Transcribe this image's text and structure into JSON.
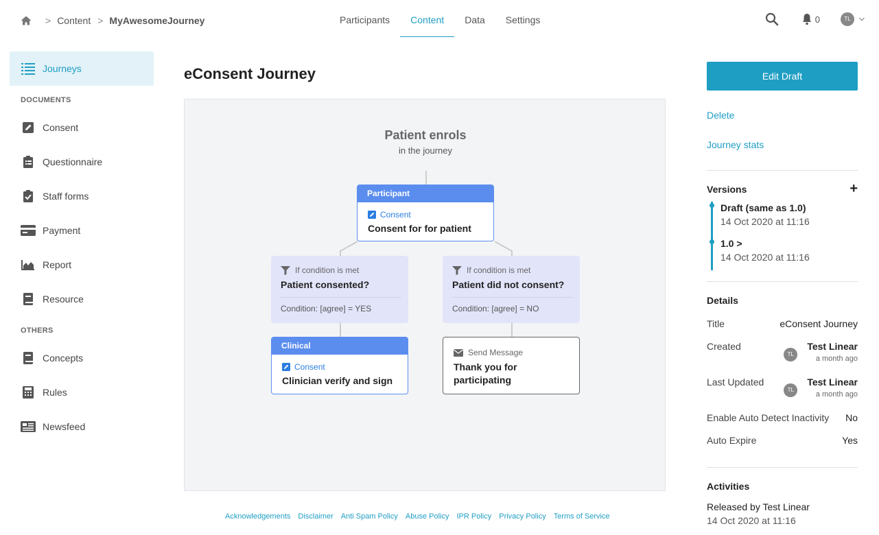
{
  "breadcrumb": {
    "items": [
      "Content",
      "MyAwesomeJourney"
    ]
  },
  "nav": {
    "tabs": [
      "Participants",
      "Content",
      "Data",
      "Settings"
    ],
    "active": "Content"
  },
  "header": {
    "notification_count": "0",
    "user_initials": "TL"
  },
  "sidebar": {
    "journeys": "Journeys",
    "documents_heading": "DOCUMENTS",
    "documents": [
      "Consent",
      "Questionnaire",
      "Staff forms",
      "Payment",
      "Report",
      "Resource"
    ],
    "others_heading": "OTHERS",
    "others": [
      "Concepts",
      "Rules",
      "Newsfeed"
    ]
  },
  "page": {
    "title": "eConsent Journey"
  },
  "flow": {
    "start_title": "Patient enrols",
    "start_subtitle": "in the journey",
    "participant_node": {
      "header": "Participant",
      "type": "Consent",
      "title": "Consent for for patient"
    },
    "cond_yes": {
      "label": "If condition is met",
      "title": "Patient consented?",
      "condition": "Condition: [agree] = YES"
    },
    "cond_no": {
      "label": "If condition is met",
      "title": "Patient did not consent?",
      "condition": "Condition: [agree] = NO"
    },
    "clinical_node": {
      "header": "Clinical",
      "type": "Consent",
      "title": "Clinician verify and sign"
    },
    "message_node": {
      "type": "Send Message",
      "title": "Thank you for participating"
    }
  },
  "footer": {
    "links": [
      "Acknowledgements",
      "Disclaimer",
      "Anti Spam Policy",
      "Abuse Policy",
      "IPR Policy",
      "Privacy Policy",
      "Terms of Service"
    ]
  },
  "right_panel": {
    "edit_button": "Edit Draft",
    "delete": "Delete",
    "journey_stats": "Journey stats",
    "versions_title": "Versions",
    "versions": [
      {
        "name": "Draft (same as 1.0)",
        "date": "14 Oct 2020 at 11:16"
      },
      {
        "name": "1.0",
        "date": "14 Oct 2020 at 11:16"
      }
    ],
    "details_title": "Details",
    "details": {
      "title_label": "Title",
      "title_value": "eConsent Journey",
      "created_label": "Created",
      "created_user": "Test Linear",
      "created_ago": "a month ago",
      "updated_label": "Last Updated",
      "updated_user": "Test Linear",
      "updated_ago": "a month ago",
      "inactivity_label": "Enable Auto Detect Inactivity",
      "inactivity_value": "No",
      "expire_label": "Auto Expire",
      "expire_value": "Yes"
    },
    "activities_title": "Activities",
    "activity": {
      "text": "Released by Test Linear",
      "date": "14 Oct 2020 at 11:16"
    }
  },
  "colors": {
    "accent": "#1f9ec4",
    "node_blue": "#5b8def",
    "condition_bg": "#e2e4fa",
    "canvas_bg": "#f3f4f6"
  }
}
